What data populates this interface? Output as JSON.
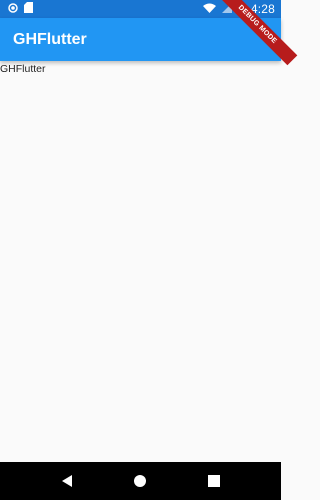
{
  "status_bar": {
    "time": "4:28",
    "icons": [
      "notification-circle-icon",
      "sd-card-icon",
      "wifi-icon",
      "signal-icon",
      "battery-icon"
    ]
  },
  "app_bar": {
    "title": "GHFlutter",
    "color": "#2196f3"
  },
  "body": {
    "text": "GHFlutter"
  },
  "debug_banner": {
    "label": "DEBUG MODE"
  },
  "nav_bar": {
    "buttons": [
      "back-icon",
      "home-icon",
      "recents-icon"
    ]
  }
}
